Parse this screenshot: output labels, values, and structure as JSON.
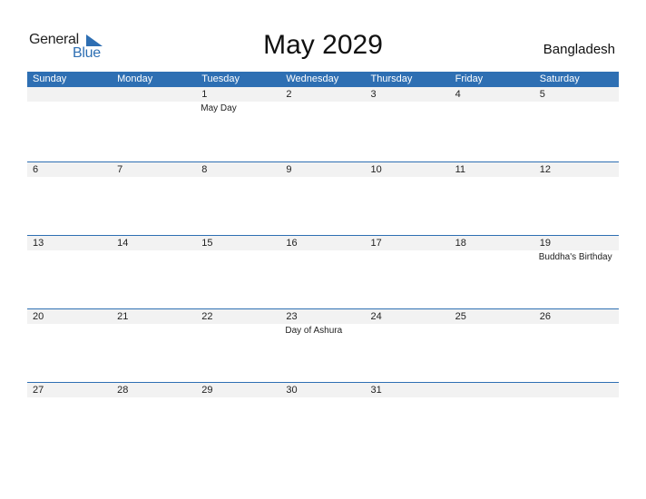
{
  "logo": {
    "part1": "General",
    "part2": "Blue"
  },
  "title": "May 2029",
  "country": "Bangladesh",
  "colors": {
    "accent": "#2e6fb3",
    "strip": "#f2f2f2"
  },
  "weekdays": [
    "Sunday",
    "Monday",
    "Tuesday",
    "Wednesday",
    "Thursday",
    "Friday",
    "Saturday"
  ],
  "weeks": [
    {
      "days": [
        {
          "num": "",
          "holiday": ""
        },
        {
          "num": "",
          "holiday": ""
        },
        {
          "num": "1",
          "holiday": "May Day"
        },
        {
          "num": "2",
          "holiday": ""
        },
        {
          "num": "3",
          "holiday": ""
        },
        {
          "num": "4",
          "holiday": ""
        },
        {
          "num": "5",
          "holiday": ""
        }
      ]
    },
    {
      "days": [
        {
          "num": "6",
          "holiday": ""
        },
        {
          "num": "7",
          "holiday": ""
        },
        {
          "num": "8",
          "holiday": ""
        },
        {
          "num": "9",
          "holiday": ""
        },
        {
          "num": "10",
          "holiday": ""
        },
        {
          "num": "11",
          "holiday": ""
        },
        {
          "num": "12",
          "holiday": ""
        }
      ]
    },
    {
      "days": [
        {
          "num": "13",
          "holiday": ""
        },
        {
          "num": "14",
          "holiday": ""
        },
        {
          "num": "15",
          "holiday": ""
        },
        {
          "num": "16",
          "holiday": ""
        },
        {
          "num": "17",
          "holiday": ""
        },
        {
          "num": "18",
          "holiday": ""
        },
        {
          "num": "19",
          "holiday": "Buddha's Birthday"
        }
      ]
    },
    {
      "days": [
        {
          "num": "20",
          "holiday": ""
        },
        {
          "num": "21",
          "holiday": ""
        },
        {
          "num": "22",
          "holiday": ""
        },
        {
          "num": "23",
          "holiday": "Day of Ashura"
        },
        {
          "num": "24",
          "holiday": ""
        },
        {
          "num": "25",
          "holiday": ""
        },
        {
          "num": "26",
          "holiday": ""
        }
      ]
    },
    {
      "days": [
        {
          "num": "27",
          "holiday": ""
        },
        {
          "num": "28",
          "holiday": ""
        },
        {
          "num": "29",
          "holiday": ""
        },
        {
          "num": "30",
          "holiday": ""
        },
        {
          "num": "31",
          "holiday": ""
        },
        {
          "num": "",
          "holiday": ""
        },
        {
          "num": "",
          "holiday": ""
        }
      ]
    }
  ]
}
